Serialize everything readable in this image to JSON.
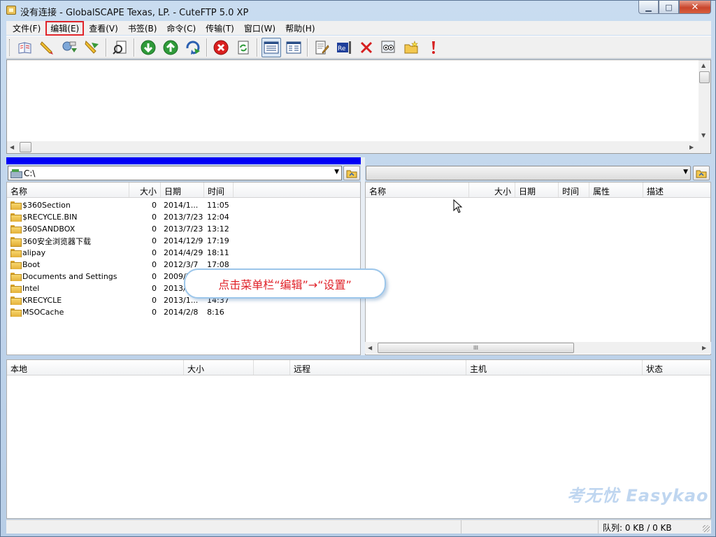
{
  "window": {
    "title": "没有连接 - GlobalSCAPE Texas, LP. - CuteFTP 5.0 XP",
    "minimize_glyph": "▁",
    "maximize_glyph": "□",
    "close_glyph": "✕"
  },
  "menu": {
    "items": [
      {
        "label": "文件(F)"
      },
      {
        "label": "编辑(E)",
        "highlighted": true
      },
      {
        "label": "查看(V)"
      },
      {
        "label": "书签(B)"
      },
      {
        "label": "命令(C)"
      },
      {
        "label": "传输(T)"
      },
      {
        "label": "窗口(W)"
      },
      {
        "label": "帮助(H)"
      }
    ]
  },
  "toolbar": {
    "icons": [
      "site-manager-icon",
      "quick-connect-icon",
      "reconnect-icon",
      "disconnect-icon",
      "remote-search-icon",
      "download-icon",
      "upload-icon",
      "refresh-transfer-icon",
      "stop-icon",
      "refresh-icon",
      "view-details-icon",
      "view-list-icon",
      "edit-icon",
      "rename-icon",
      "delete-icon",
      "view-file-icon",
      "new-folder-icon",
      "alert-icon"
    ]
  },
  "local": {
    "path": "C:\\",
    "columns": {
      "name": "名称",
      "size": "大小",
      "date": "日期",
      "time": "时间"
    },
    "rows": [
      {
        "name": "$360Section",
        "size": "0",
        "date": "2014/1...",
        "time": "11:05"
      },
      {
        "name": "$RECYCLE.BIN",
        "size": "0",
        "date": "2013/7/23",
        "time": "12:04"
      },
      {
        "name": "360SANDBOX",
        "size": "0",
        "date": "2013/7/23",
        "time": "13:12"
      },
      {
        "name": "360安全浏览器下载",
        "size": "0",
        "date": "2014/12/9",
        "time": "17:19"
      },
      {
        "name": "alipay",
        "size": "0",
        "date": "2014/4/29",
        "time": "18:11"
      },
      {
        "name": "Boot",
        "size": "0",
        "date": "2012/3/7",
        "time": "17:08"
      },
      {
        "name": "Documents and Settings",
        "size": "0",
        "date": "2009/7...",
        "time": ""
      },
      {
        "name": "Intel",
        "size": "0",
        "date": "2013/...",
        "time": ""
      },
      {
        "name": "KRECYCLE",
        "size": "0",
        "date": "2013/1...",
        "time": "14:37"
      },
      {
        "name": "MSOCache",
        "size": "0",
        "date": "2014/2/8",
        "time": "8:16"
      }
    ]
  },
  "remote": {
    "path": "",
    "columns": {
      "name": "名称",
      "size": "大小",
      "date": "日期",
      "time": "时间",
      "attributes": "属性",
      "description": "描述"
    },
    "scroll_grip": "III"
  },
  "queue": {
    "columns": {
      "local": "本地",
      "size": "大小",
      "remote": "远程",
      "host": "主机",
      "status": "状态"
    }
  },
  "callout": {
    "text": "点击菜单栏“编辑”→“设置”"
  },
  "watermark": {
    "text": "考无忧 Easykao"
  },
  "status": {
    "queue": "队列: 0 KB / 0 KB"
  },
  "colors": {
    "progress": "#0000f5",
    "highlight_border": "#e0252a",
    "callout_text": "#e0232a"
  }
}
